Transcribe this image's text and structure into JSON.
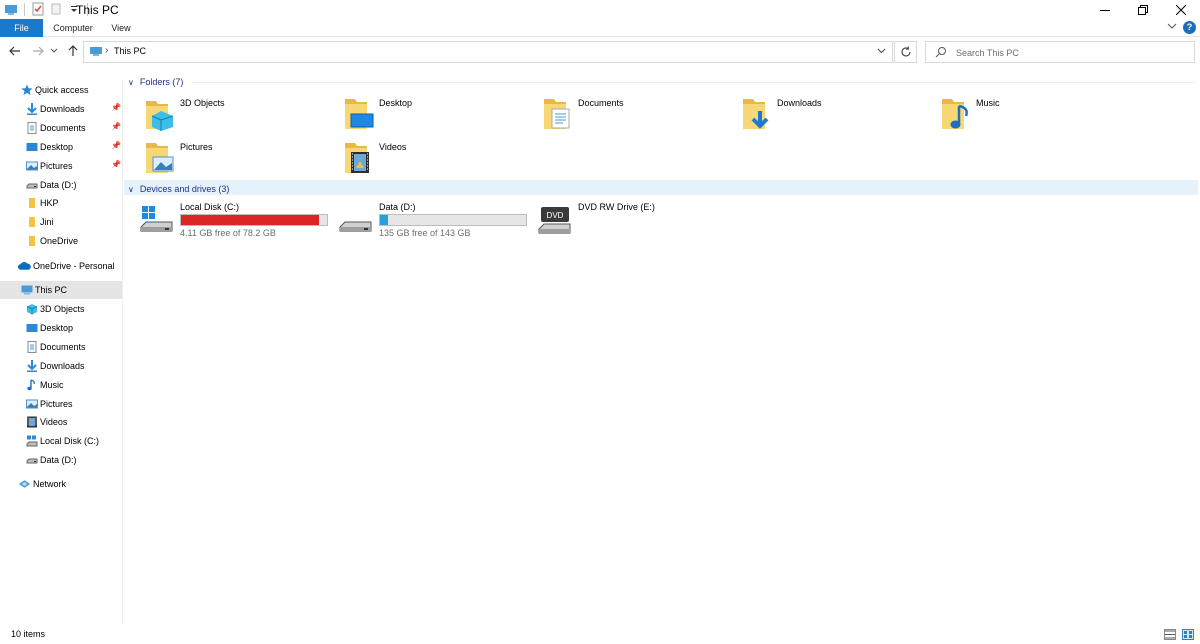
{
  "window": {
    "title": "This PC"
  },
  "ribbon": {
    "tabs": [
      "File",
      "Computer",
      "View"
    ]
  },
  "address": {
    "path": "This PC"
  },
  "search": {
    "placeholder": "Search This PC"
  },
  "sidebar": {
    "quick_access": {
      "label": "Quick access",
      "items": [
        {
          "label": "Downloads",
          "icon": "downloads-icon",
          "pinned": true
        },
        {
          "label": "Documents",
          "icon": "documents-icon",
          "pinned": true
        },
        {
          "label": "Desktop",
          "icon": "desktop-icon",
          "pinned": true
        },
        {
          "label": "Pictures",
          "icon": "pictures-icon",
          "pinned": true
        },
        {
          "label": "Data (D:)",
          "icon": "drive-icon",
          "pinned": false
        },
        {
          "label": "HKP",
          "icon": "folder-icon",
          "pinned": false
        },
        {
          "label": "Jini",
          "icon": "folder-icon",
          "pinned": false
        },
        {
          "label": "OneDrive",
          "icon": "folder-icon",
          "pinned": false
        }
      ]
    },
    "onedrive": {
      "label": "OneDrive - Personal"
    },
    "this_pc": {
      "label": "This PC",
      "items": [
        {
          "label": "3D Objects",
          "icon": "3d-objects-icon"
        },
        {
          "label": "Desktop",
          "icon": "desktop-icon"
        },
        {
          "label": "Documents",
          "icon": "documents-icon"
        },
        {
          "label": "Downloads",
          "icon": "downloads-icon"
        },
        {
          "label": "Music",
          "icon": "music-icon"
        },
        {
          "label": "Pictures",
          "icon": "pictures-icon"
        },
        {
          "label": "Videos",
          "icon": "videos-icon"
        },
        {
          "label": "Local Disk (C:)",
          "icon": "windows-drive-icon"
        },
        {
          "label": "Data (D:)",
          "icon": "drive-icon"
        }
      ]
    },
    "network": {
      "label": "Network"
    }
  },
  "folders": {
    "header": "Folders (7)",
    "items": [
      {
        "label": "3D Objects",
        "icon": "3d-objects-icon"
      },
      {
        "label": "Desktop",
        "icon": "desktop-icon"
      },
      {
        "label": "Documents",
        "icon": "documents-icon"
      },
      {
        "label": "Downloads",
        "icon": "downloads-icon"
      },
      {
        "label": "Music",
        "icon": "music-icon"
      },
      {
        "label": "Pictures",
        "icon": "pictures-icon"
      },
      {
        "label": "Videos",
        "icon": "videos-icon"
      }
    ]
  },
  "devices": {
    "header": "Devices and drives (3)",
    "items": [
      {
        "label": "Local Disk (C:)",
        "free_text": "4.11 GB free of 78.2 GB",
        "used_fraction": 0.947,
        "bar_color": "#da2626",
        "icon": "windows-drive-icon"
      },
      {
        "label": "Data (D:)",
        "free_text": "135 GB free of 143 GB",
        "used_fraction": 0.056,
        "bar_color": "#26a0da",
        "icon": "drive-icon"
      },
      {
        "label": "DVD RW Drive (E:)",
        "icon": "dvd-drive-icon"
      }
    ]
  },
  "status": {
    "item_count": "10 items"
  },
  "colors": {
    "accent": "#1979ca",
    "group_header": "#1e3287",
    "selected_bg": "#e5e5e5",
    "hover_band": "#e5f1fb"
  }
}
